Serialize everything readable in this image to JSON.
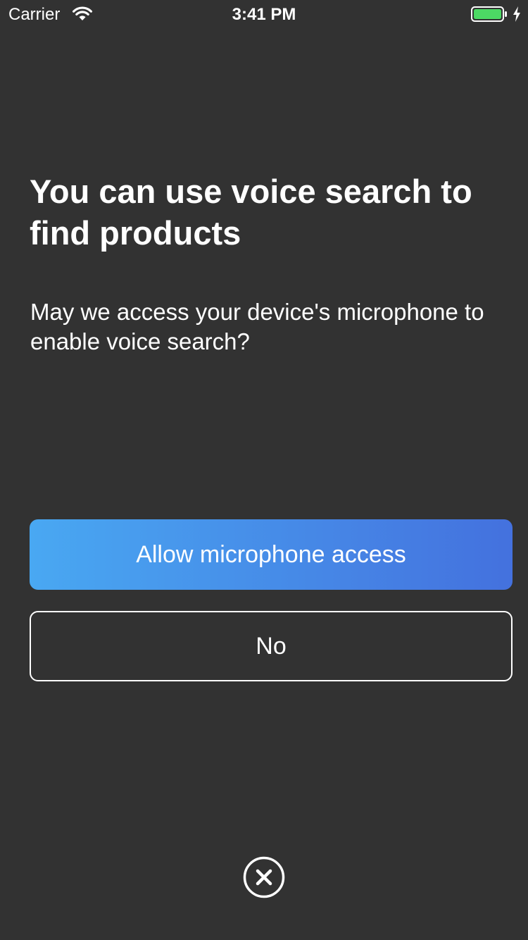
{
  "status_bar": {
    "carrier": "Carrier",
    "time": "3:41 PM",
    "battery_color": "#4cd964",
    "icons": [
      "wifi-icon",
      "battery-icon",
      "charging-bolt-icon"
    ]
  },
  "prompt": {
    "title": "You can use voice search to find products",
    "message": "May we access your device's microphone to enable voice search?"
  },
  "actions": {
    "allow_label": "Allow microphone access",
    "deny_label": "No",
    "close_icon": "close-circle-icon"
  },
  "colors": {
    "background": "#323232",
    "primary_gradient_start": "#49a8f2",
    "primary_gradient_end": "#4471de",
    "text": "#ffffff"
  }
}
